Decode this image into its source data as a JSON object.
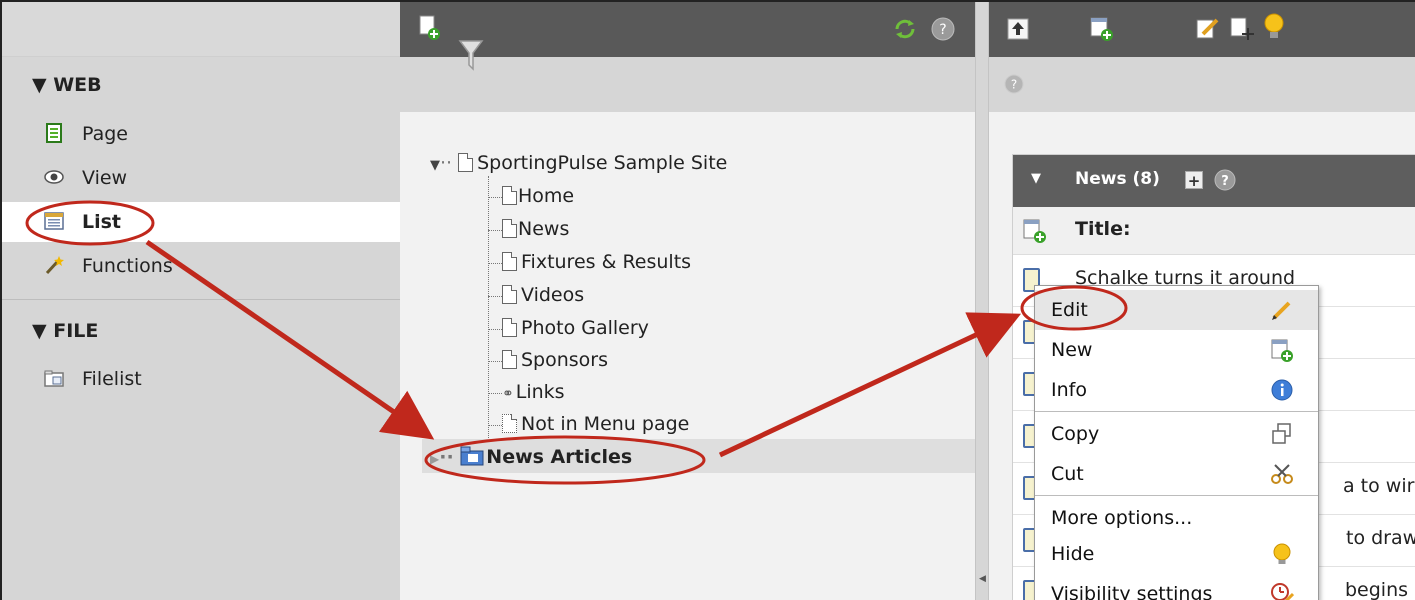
{
  "module_menu": {
    "web_heading": "▼ WEB",
    "items": [
      {
        "label": "Page",
        "icon": "page-icon"
      },
      {
        "label": "View",
        "icon": "eye-icon"
      },
      {
        "label": "List",
        "icon": "list-icon",
        "selected": true
      },
      {
        "label": "Functions",
        "icon": "wand-icon"
      }
    ],
    "file_heading": "▼ FILE",
    "file_items": [
      {
        "label": "Filelist",
        "icon": "folder-icon"
      }
    ]
  },
  "page_tree": {
    "root": "SportingPulse Sample Site",
    "children": [
      "Home",
      "News",
      "Fixtures & Results",
      "Videos",
      "Photo Gallery",
      "Sponsors",
      "Links",
      "Not in Menu page",
      "News Articles"
    ]
  },
  "news_panel": {
    "header": "News (8)",
    "column_title": "Title:",
    "rows": [
      "Schalke turns it around",
      "",
      "",
      "",
      "a to wir",
      "to draw",
      "begins"
    ]
  },
  "context_menu": {
    "items": [
      {
        "label": "Edit",
        "icon": "pencil-icon"
      },
      {
        "label": "New",
        "icon": "new-record-icon"
      },
      {
        "label": "Info",
        "icon": "info-icon"
      },
      {
        "label": "Copy",
        "icon": "copy-icon"
      },
      {
        "label": "Cut",
        "icon": "scissors-icon"
      },
      {
        "label": "More options...",
        "icon": ""
      },
      {
        "label": "Hide",
        "icon": "lightbulb-icon"
      },
      {
        "label": "Visibility settings",
        "icon": "clock-pencil-icon"
      }
    ]
  },
  "colors": {
    "toolbar_dark": "#595959",
    "annotation_red": "#c0281c",
    "selected_bg": "#ffffff",
    "menu_bg": "#d6d6d6"
  }
}
